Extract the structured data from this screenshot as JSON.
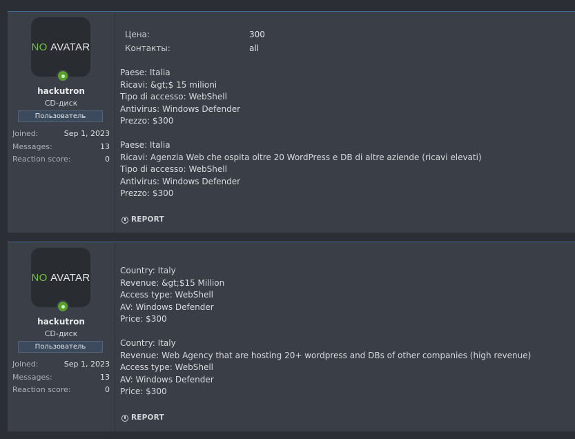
{
  "posts": [
    {
      "author": {
        "avatar_no": "NO",
        "avatar_avatar": "AVATAR",
        "username": "hackutron",
        "title": "CD-диск",
        "badge": "Пользователь",
        "stats": [
          {
            "label": "Joined:",
            "value": "Sep 1, 2023"
          },
          {
            "label": "Messages:",
            "value": "13"
          },
          {
            "label": "Reaction score:",
            "value": "0"
          }
        ],
        "online_icon": "online-status-icon"
      },
      "fields": [
        {
          "label": "Цена:",
          "value": "300"
        },
        {
          "label": "Контакты:",
          "value": "all"
        }
      ],
      "blocks": [
        [
          "Paese: Italia",
          "Ricavi: &gt;$ 15 milioni",
          "Tipo di accesso: WebShell",
          "Antivirus: Windows Defender",
          "Prezzo: $300"
        ],
        [
          "Paese: Italia",
          "Ricavi: Agenzia Web che ospita oltre 20 WordPress e DB di altre aziende (ricavi elevati)",
          "Tipo di accesso: WebShell",
          "Antivirus: Windows Defender",
          "Prezzo: $300"
        ]
      ],
      "report_label": "REPORT"
    },
    {
      "author": {
        "avatar_no": "NO",
        "avatar_avatar": "AVATAR",
        "username": "hackutron",
        "title": "CD-диск",
        "badge": "Пользователь",
        "stats": [
          {
            "label": "Joined:",
            "value": "Sep 1, 2023"
          },
          {
            "label": "Messages:",
            "value": "13"
          },
          {
            "label": "Reaction score:",
            "value": "0"
          }
        ],
        "online_icon": "online-status-icon"
      },
      "blocks": [
        [
          "Country: Italy",
          "Revenue: &gt;$15 Million",
          "Access type: WebShell",
          "AV: Windows Defender",
          "Price: $300"
        ],
        [
          "Country: Italy",
          "Revenue: Web Agency that are hosting 20+ wordpress and DBs of other companies (high revenue)",
          "Access type: WebShell",
          "AV: Windows Defender",
          "Price: $300"
        ]
      ],
      "report_label": "REPORT"
    }
  ],
  "colors": {
    "page_bg": "#2b2e35",
    "post_bg": "#3a3e46",
    "accent_border": "#3d6f9e",
    "online_green": "#5a9e2f",
    "avatar_no_green": "#7cc04a"
  }
}
